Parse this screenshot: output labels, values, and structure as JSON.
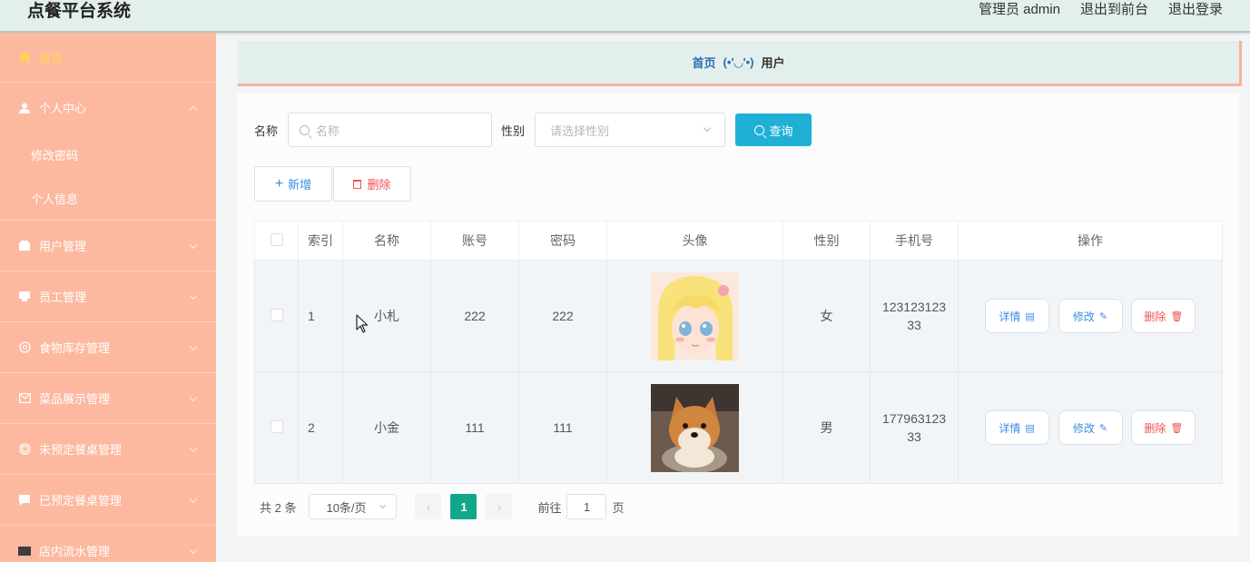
{
  "header": {
    "brand": "点餐平台系统",
    "links": [
      "管理员 admin",
      "退出到前台",
      "退出登录"
    ]
  },
  "sidebar": {
    "items": [
      {
        "label": "首页",
        "icon": "home-icon",
        "active": true
      },
      {
        "label": "个人中心",
        "icon": "user-icon",
        "expanded": true,
        "children": [
          "修改密码",
          "个人信息"
        ]
      },
      {
        "label": "用户管理",
        "icon": "folder-icon"
      },
      {
        "label": "员工管理",
        "icon": "folder-icon"
      },
      {
        "label": "食物库存管理",
        "icon": "aperture-icon"
      },
      {
        "label": "菜品展示管理",
        "icon": "mail-icon"
      },
      {
        "label": "未预定餐桌管理",
        "icon": "target-icon"
      },
      {
        "label": "已预定餐桌管理",
        "icon": "chat-icon"
      },
      {
        "label": "店内流水管理",
        "icon": "ticket-icon"
      }
    ]
  },
  "breadcrumb": {
    "home": "首页",
    "separator": "(•'◡'•)",
    "current": "用户"
  },
  "search": {
    "name_label": "名称",
    "name_placeholder": "名称",
    "gender_label": "性别",
    "gender_placeholder": "请选择性别",
    "query_button": "查询"
  },
  "actions": {
    "add_label": "新增",
    "delete_label": "删除"
  },
  "table": {
    "columns": [
      "索引",
      "名称",
      "账号",
      "密码",
      "头像",
      "性别",
      "手机号",
      "操作"
    ],
    "rows": [
      {
        "index": "1",
        "name": "小札",
        "account": "222",
        "password": "222",
        "avatar": "anime-girl-avatar",
        "gender": "女",
        "phone_line1": "123123123",
        "phone_line2": "33"
      },
      {
        "index": "2",
        "name": "小金",
        "account": "111",
        "password": "111",
        "avatar": "shiba-dog-avatar",
        "gender": "男",
        "phone_line1": "177963123",
        "phone_line2": "33"
      }
    ],
    "row_actions": {
      "detail": "详情",
      "edit": "修改",
      "delete": "删除"
    }
  },
  "pagination": {
    "total": "共 2 条",
    "page_size": "10条/页",
    "current_page": "1",
    "goto_label": "前往",
    "goto_value": "1",
    "page_unit": "页"
  },
  "colors": {
    "sidebar_bg": "#fdb9a0",
    "header_bg": "#e3efed",
    "query_button": "#20b0d6",
    "active_page": "#11a88a",
    "active_menu": "#ffd84a"
  }
}
